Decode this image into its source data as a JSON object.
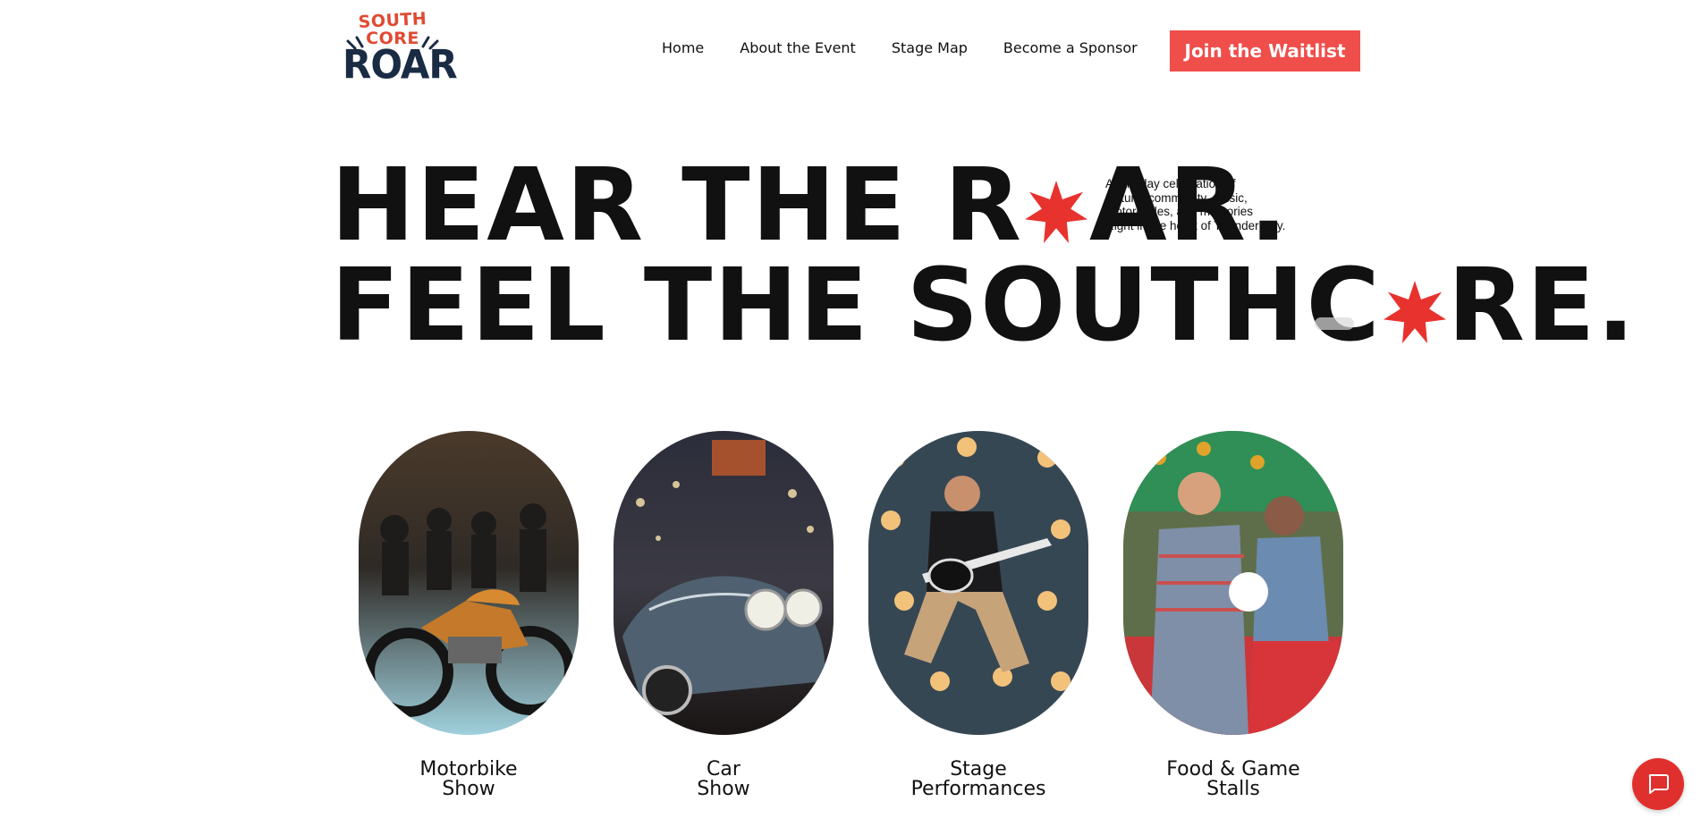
{
  "logo": {
    "line1": "SOUTH",
    "line2": "CORE",
    "line3": "ROAR"
  },
  "nav": {
    "items": [
      {
        "label": "Home"
      },
      {
        "label": "About the Event"
      },
      {
        "label": "Stage Map"
      },
      {
        "label": "Become a Sponsor"
      }
    ],
    "cta": "Join the Waitlist"
  },
  "hero": {
    "line1_a": "HEAR THE R",
    "line1_b": "AR.",
    "line2_a": "FEEL THE SOUTHC",
    "line2_b": "RE."
  },
  "tagline": {
    "l1": "A one-day celebration of",
    "l2": "culture, community, music,",
    "l3": "motorcycles, and memories",
    "l4": "Right in the heart of Thunder Bay."
  },
  "cards": [
    {
      "l1": "Motorbike",
      "l2": "Show"
    },
    {
      "l1": "Car",
      "l2": "Show"
    },
    {
      "l1": "Stage",
      "l2": "Performances"
    },
    {
      "l1": "Food & Game",
      "l2": "Stalls"
    }
  ],
  "colors": {
    "accent": "#ef4e4b",
    "star": "#e8322e",
    "logo_red": "#e04a33",
    "logo_navy": "#1a2b44"
  },
  "icons": {
    "chat": "chat-bubble-icon"
  }
}
